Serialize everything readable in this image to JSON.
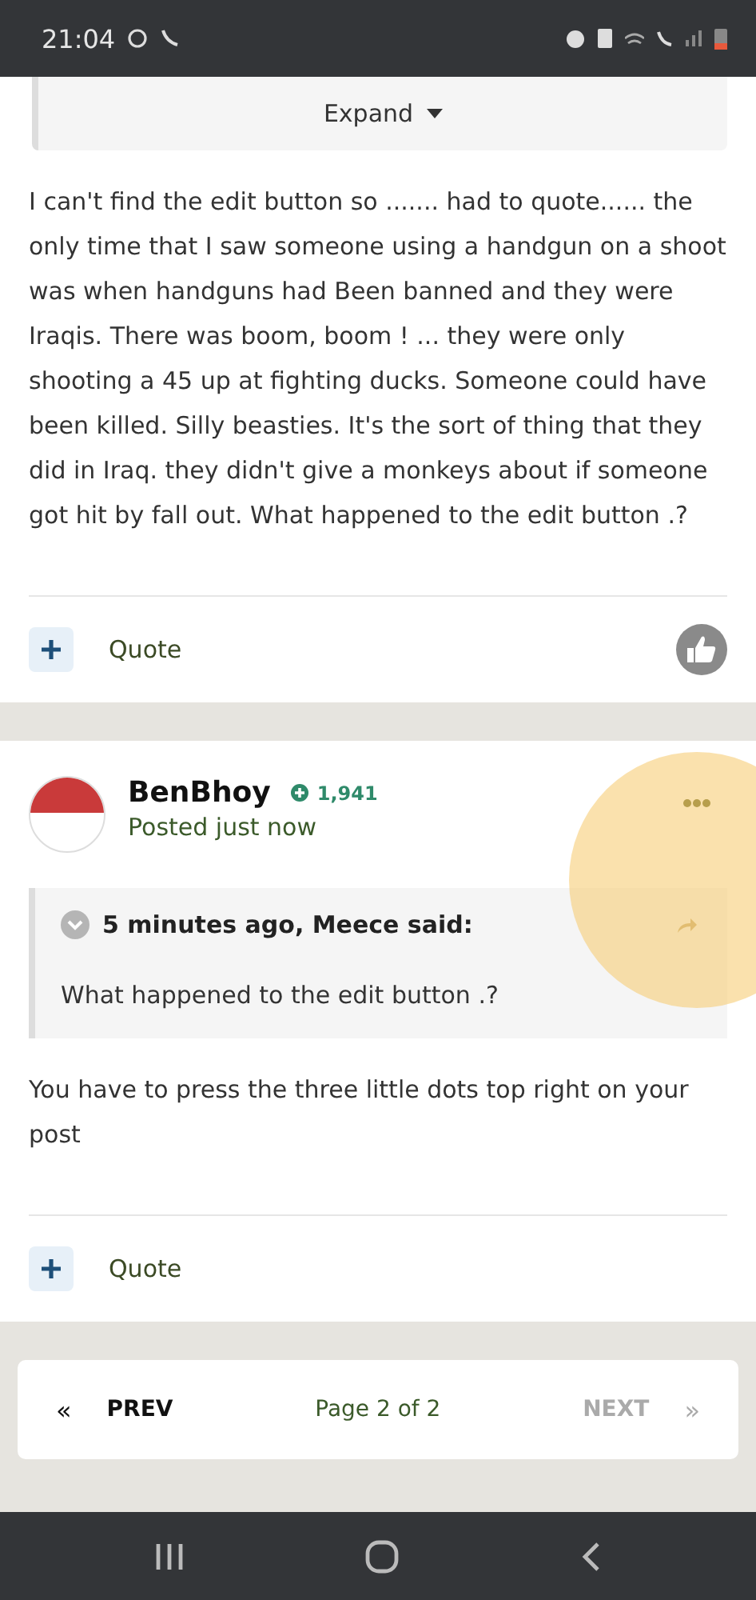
{
  "status_bar": {
    "time": "21:04"
  },
  "posts": [
    {
      "quote": {
        "expand_label": "Expand"
      },
      "body": "I can't find the edit button so ....... had to quote......  the only time that I  saw someone using a handgun on a shoot was when handguns had Been banned and they were Iraqis. There was boom,  boom !  ... they were only shooting a 45 up at fighting ducks. Someone could have been killed.  Silly beasties.   It's the sort of thing that they did in Iraq.  they didn't give a monkeys about if someone got hit by fall out.  What happened to the edit button .?",
      "quote_label": "Quote",
      "liked": true
    },
    {
      "author": {
        "name": "BenBhoy",
        "reputation": "1,941",
        "posted": "Posted just now"
      },
      "quote": {
        "header": "5 minutes ago, Meece said:",
        "text": "What happened to the edit button .?"
      },
      "body": "You have to press the three little dots top right on your post",
      "quote_label": "Quote",
      "liked": false
    }
  ],
  "pagination": {
    "prev_arrow": "«",
    "next_arrow": "»",
    "prev": "PREV",
    "page": "Page 2 of 2",
    "next": "NEXT",
    "next_disabled": true
  }
}
